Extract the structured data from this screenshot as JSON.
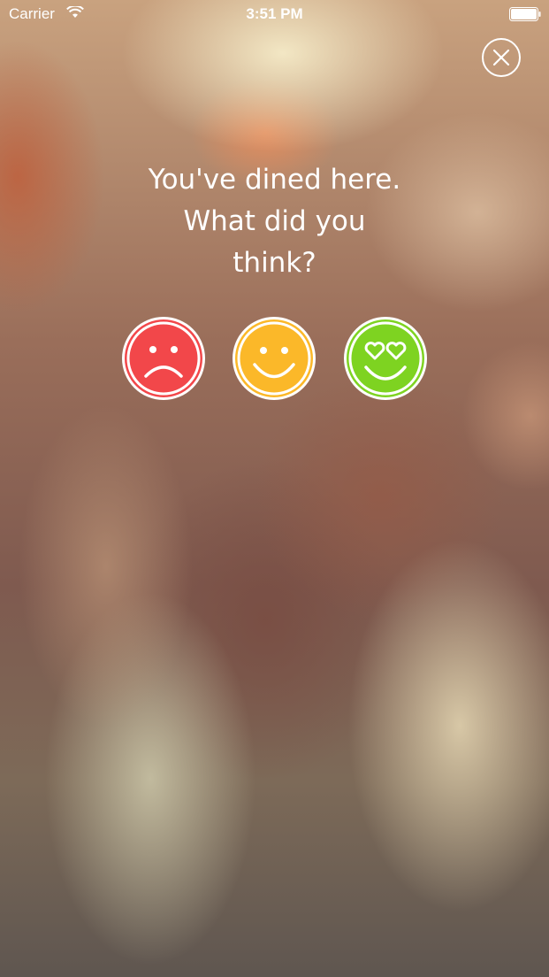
{
  "status_bar": {
    "carrier": "Carrier",
    "time": "3:51 PM",
    "wifi_icon": "wifi-icon",
    "battery_icon": "battery-icon"
  },
  "close_icon": "close-icon",
  "prompt": {
    "line1": "You've dined here.",
    "line2": "What did you",
    "line3": "think?"
  },
  "ratings": [
    {
      "name": "sad-face-icon",
      "color": "#f2474a"
    },
    {
      "name": "smile-face-icon",
      "color": "#fbb829"
    },
    {
      "name": "heart-eyes-face-icon",
      "color": "#7ed321"
    }
  ]
}
